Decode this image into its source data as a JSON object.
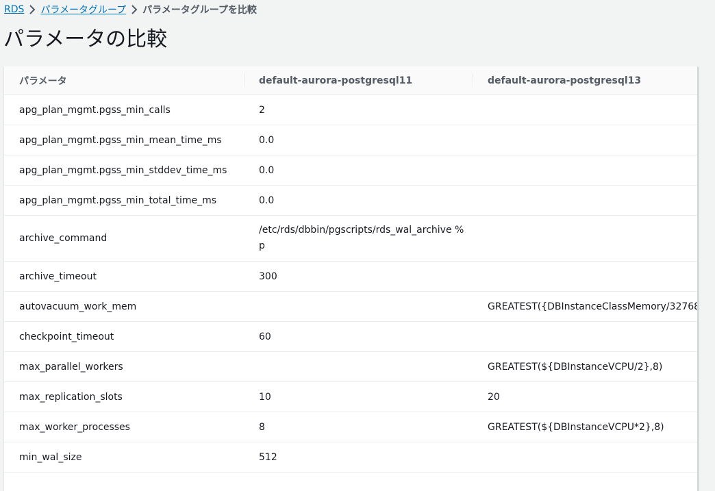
{
  "breadcrumb": {
    "items": [
      "RDS",
      "パラメータグループ"
    ],
    "current": "パラメータグループを比較"
  },
  "page_title": "パラメータの比較",
  "table": {
    "headers": [
      "パラメータ",
      "default-aurora-postgresql11",
      "default-aurora-postgresql13"
    ],
    "rows": [
      {
        "param": "apg_plan_mgmt.pgss_min_calls",
        "v11": "2",
        "v13": ""
      },
      {
        "param": "apg_plan_mgmt.pgss_min_mean_time_ms",
        "v11": "0.0",
        "v13": ""
      },
      {
        "param": "apg_plan_mgmt.pgss_min_stddev_time_ms",
        "v11": "0.0",
        "v13": ""
      },
      {
        "param": "apg_plan_mgmt.pgss_min_total_time_ms",
        "v11": "0.0",
        "v13": ""
      },
      {
        "param": "archive_command",
        "v11": "/etc/rds/dbbin/pgscripts/rds_wal_archive %p",
        "v13": ""
      },
      {
        "param": "archive_timeout",
        "v11": "300",
        "v13": ""
      },
      {
        "param": "autovacuum_work_mem",
        "v11": "",
        "v13": "GREATEST({DBInstanceClassMemory/32768"
      },
      {
        "param": "checkpoint_timeout",
        "v11": "60",
        "v13": ""
      },
      {
        "param": "max_parallel_workers",
        "v11": "",
        "v13": "GREATEST(${DBInstanceVCPU/2},8)"
      },
      {
        "param": "max_replication_slots",
        "v11": "10",
        "v13": "20"
      },
      {
        "param": "max_worker_processes",
        "v11": "8",
        "v13": "GREATEST(${DBInstanceVCPU*2},8)"
      },
      {
        "param": "min_wal_size",
        "v11": "512",
        "v13": ""
      }
    ]
  }
}
